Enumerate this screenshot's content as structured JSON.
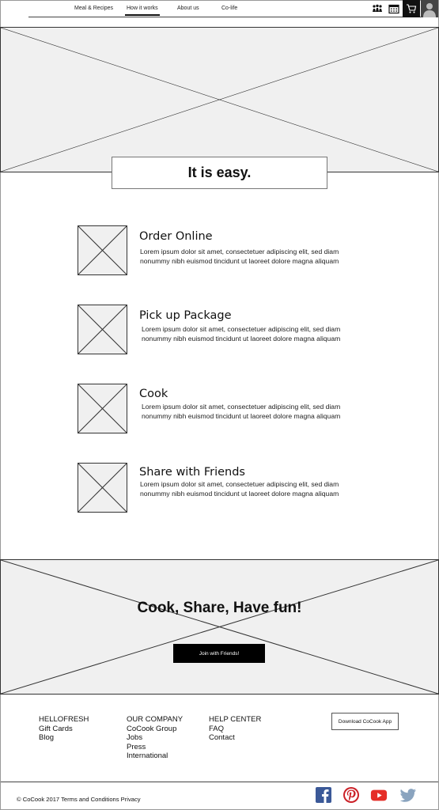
{
  "nav": {
    "items": [
      "Meal & Recipes",
      "How it works",
      "About us",
      "Co-life"
    ],
    "active_index": 1,
    "icons": [
      "community-icon",
      "calendar-icon",
      "cart-icon",
      "user-avatar-icon"
    ]
  },
  "hero": {
    "title": "It is easy."
  },
  "steps": [
    {
      "title": "Order Online",
      "text": "Lorem ipsum dolor sit amet, consectetuer adipiscing elit, sed diam nonummy nibh euismod tincidunt ut laoreet dolore magna aliquam"
    },
    {
      "title": "Pick up Package",
      "text": "Lorem ipsum dolor sit amet, consectetuer adipiscing elit, sed diam nonummy nibh euismod tincidunt ut laoreet dolore magna aliquam"
    },
    {
      "title": "Cook",
      "text": "Lorem ipsum dolor sit amet, consectetuer adipiscing elit, sed diam nonummy nibh euismod tincidunt ut laoreet dolore magna aliquam"
    },
    {
      "title": "Share with Friends",
      "text": "Lorem ipsum dolor sit amet, consectetuer adipiscing elit, sed diam nonummy nibh euismod tincidunt ut laoreet dolore magna aliquam"
    }
  ],
  "cta": {
    "title": "Cook, Share, Have fun!",
    "button": "Join with Friends!"
  },
  "footer": {
    "columns": [
      {
        "heading": "HELLOFRESH",
        "links": [
          "Gift Cards",
          "Blog"
        ]
      },
      {
        "heading": "OUR COMPANY",
        "links": [
          "CoCook Group",
          "Jobs",
          "Press",
          "International"
        ]
      },
      {
        "heading": "HELP CENTER",
        "links": [
          "FAQ",
          "Contact"
        ]
      }
    ],
    "app_button": "Download CoCook App",
    "copyright": "© CoCook 2017 Terms and Conditions Privacy",
    "social": [
      "facebook-icon",
      "pinterest-icon",
      "youtube-icon",
      "twitter-icon"
    ],
    "colors": {
      "facebook": "#3b5998",
      "pinterest": "#cb2027",
      "youtube": "#e52d27",
      "twitter": "#8aa4bf"
    }
  }
}
